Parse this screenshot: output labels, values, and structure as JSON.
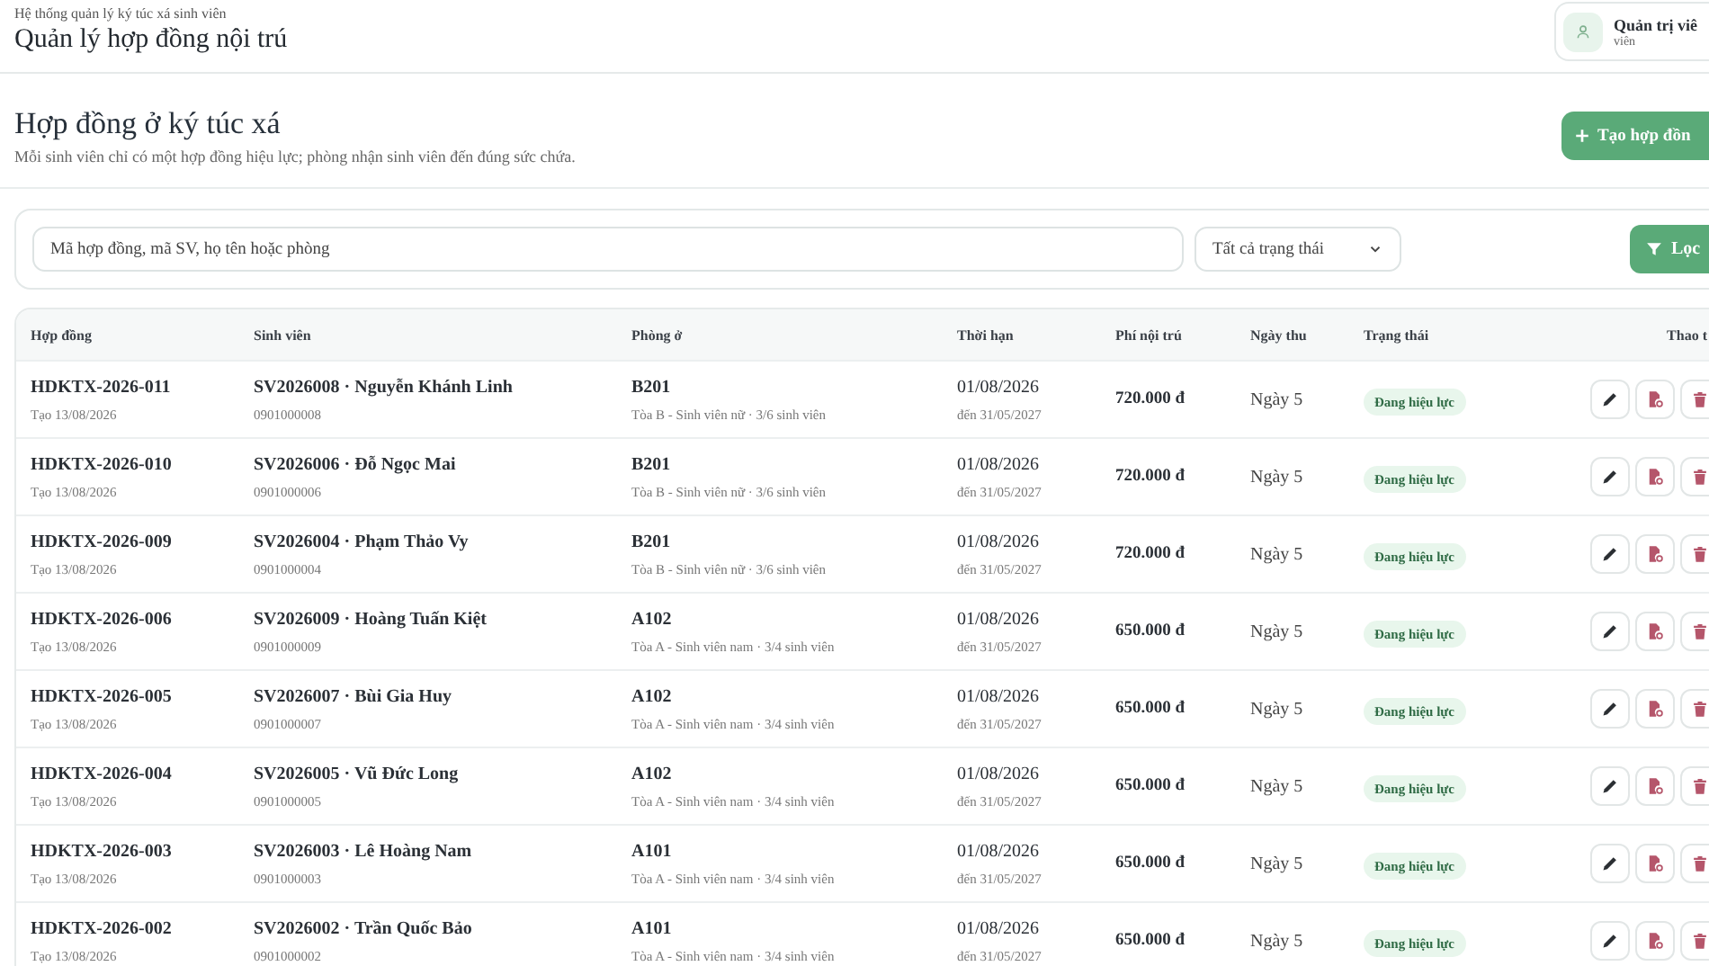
{
  "header": {
    "breadcrumb": "Hệ thống quản lý ký túc xá sinh viên",
    "title": "Quản lý hợp đồng nội trú",
    "user": {
      "name": "Quản trị viê",
      "role": "viên"
    }
  },
  "section": {
    "title": "Hợp đồng ở ký túc xá",
    "subtitle": "Mỗi sinh viên chỉ có một hợp đồng hiệu lực; phòng nhận sinh viên đến đúng sức chứa.",
    "create_button": "Tạo hợp đồn"
  },
  "filters": {
    "search": {
      "placeholder": "Mã hợp đồng, mã SV, họ tên hoặc phòng"
    },
    "status_select": "Tất cả trạng thái",
    "filter_button": "Lọc"
  },
  "table": {
    "columns": [
      "Hợp đồng",
      "Sinh viên",
      "Phòng ở",
      "Thời hạn",
      "Phí nội trú",
      "Ngày thu",
      "Trạng thái",
      "Thao t"
    ],
    "rows": [
      {
        "contract": "HDKTX-2026-011",
        "created": "Tạo 13/08/2026",
        "student": "SV2026008 · Nguyễn Khánh Linh",
        "phone": "0901000008",
        "room": "B201",
        "room_info": "Tòa B - Sinh viên nữ · 3/6 sinh viên",
        "start": "01/08/2026",
        "end": "đến 31/05/2027",
        "fee": "720.000 đ",
        "due": "Ngày 5",
        "status": {
          "label": "Đang hiệu lực",
          "kind": "active"
        }
      },
      {
        "contract": "HDKTX-2026-010",
        "created": "Tạo 13/08/2026",
        "student": "SV2026006 · Đỗ Ngọc Mai",
        "phone": "0901000006",
        "room": "B201",
        "room_info": "Tòa B - Sinh viên nữ · 3/6 sinh viên",
        "start": "01/08/2026",
        "end": "đến 31/05/2027",
        "fee": "720.000 đ",
        "due": "Ngày 5",
        "status": {
          "label": "Đang hiệu lực",
          "kind": "active"
        }
      },
      {
        "contract": "HDKTX-2026-009",
        "created": "Tạo 13/08/2026",
        "student": "SV2026004 · Phạm Thảo Vy",
        "phone": "0901000004",
        "room": "B201",
        "room_info": "Tòa B - Sinh viên nữ · 3/6 sinh viên",
        "start": "01/08/2026",
        "end": "đến 31/05/2027",
        "fee": "720.000 đ",
        "due": "Ngày 5",
        "status": {
          "label": "Đang hiệu lực",
          "kind": "active"
        }
      },
      {
        "contract": "HDKTX-2026-006",
        "created": "Tạo 13/08/2026",
        "student": "SV2026009 · Hoàng Tuấn Kiệt",
        "phone": "0901000009",
        "room": "A102",
        "room_info": "Tòa A - Sinh viên nam · 3/4 sinh viên",
        "start": "01/08/2026",
        "end": "đến 31/05/2027",
        "fee": "650.000 đ",
        "due": "Ngày 5",
        "status": {
          "label": "Đang hiệu lực",
          "kind": "active"
        }
      },
      {
        "contract": "HDKTX-2026-005",
        "created": "Tạo 13/08/2026",
        "student": "SV2026007 · Bùi Gia Huy",
        "phone": "0901000007",
        "room": "A102",
        "room_info": "Tòa A - Sinh viên nam · 3/4 sinh viên",
        "start": "01/08/2026",
        "end": "đến 31/05/2027",
        "fee": "650.000 đ",
        "due": "Ngày 5",
        "status": {
          "label": "Đang hiệu lực",
          "kind": "active"
        }
      },
      {
        "contract": "HDKTX-2026-004",
        "created": "Tạo 13/08/2026",
        "student": "SV2026005 · Vũ Đức Long",
        "phone": "0901000005",
        "room": "A102",
        "room_info": "Tòa A - Sinh viên nam · 3/4 sinh viên",
        "start": "01/08/2026",
        "end": "đến 31/05/2027",
        "fee": "650.000 đ",
        "due": "Ngày 5",
        "status": {
          "label": "Đang hiệu lực",
          "kind": "active"
        }
      },
      {
        "contract": "HDKTX-2026-003",
        "created": "Tạo 13/08/2026",
        "student": "SV2026003 · Lê Hoàng Nam",
        "phone": "0901000003",
        "room": "A101",
        "room_info": "Tòa A - Sinh viên nam · 3/4 sinh viên",
        "start": "01/08/2026",
        "end": "đến 31/05/2027",
        "fee": "650.000 đ",
        "due": "Ngày 5",
        "status": {
          "label": "Đang hiệu lực",
          "kind": "active"
        }
      },
      {
        "contract": "HDKTX-2026-002",
        "created": "Tạo 13/08/2026",
        "student": "SV2026002 · Trần Quốc Bảo",
        "phone": "0901000002",
        "room": "A101",
        "room_info": "Tòa A - Sinh viên nam · 3/4 sinh viên",
        "start": "01/08/2026",
        "end": "đến 31/05/2027",
        "fee": "650.000 đ",
        "due": "Ngày 5",
        "status": {
          "label": "Đang hiệu lực",
          "kind": "active"
        }
      }
    ]
  }
}
